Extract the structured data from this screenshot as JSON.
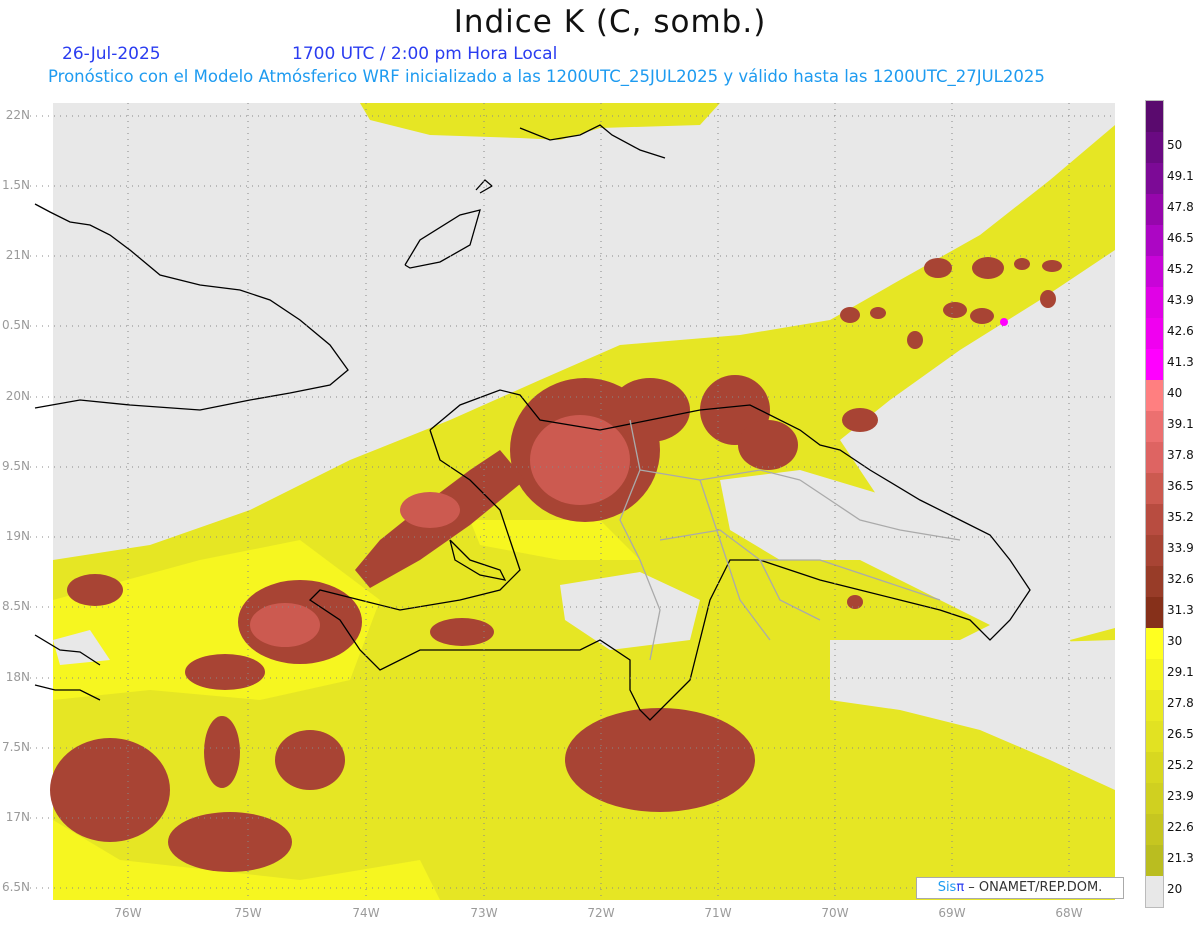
{
  "header": {
    "title": "Indice K (C, somb.)",
    "date": "26-Jul-2025",
    "time": "1700 UTC / 2:00 pm Hora Local",
    "subtitle": "Pronóstico con el Modelo Atmósferico WRF inicializado a las 1200UTC_25JUL2025 y válido hasta las  1200UTC_27JUL2025"
  },
  "axes": {
    "lat_labels": [
      "22N",
      "1.5N",
      "21N",
      "0.5N",
      "20N",
      "9.5N",
      "19N",
      "8.5N",
      "18N",
      "7.5N",
      "17N",
      "6.5N"
    ],
    "lon_labels": [
      "76W",
      "75W",
      "74W",
      "73W",
      "72W",
      "71W",
      "70W",
      "69W",
      "68W"
    ]
  },
  "colorbar": {
    "labels": [
      "50",
      "49.1",
      "47.8",
      "46.5",
      "45.2",
      "43.9",
      "42.6",
      "41.3",
      "40",
      "39.1",
      "37.8",
      "36.5",
      "35.2",
      "33.9",
      "32.6",
      "31.3",
      "30",
      "29.1",
      "27.8",
      "26.5",
      "25.2",
      "23.9",
      "22.6",
      "21.3",
      "20"
    ],
    "colors": [
      "#5a0a6e",
      "#6a0a82",
      "#7c0a96",
      "#9606ac",
      "#ac06c4",
      "#c804d8",
      "#e002e6",
      "#f000f0",
      "#ff00ff",
      "#ff7f80",
      "#ec7070",
      "#de6462",
      "#cc5a50",
      "#b84c40",
      "#a84434",
      "#983c28",
      "#86301a",
      "#ffff20",
      "#f4f420",
      "#eaea22",
      "#e2e222",
      "#d8d820",
      "#d0d020",
      "#c6c620",
      "#babd20",
      "#e8e8e8"
    ]
  },
  "credit": {
    "brand_a": "Sis",
    "brand_b": "π",
    "text": " –  ONAMET/REP.DOM."
  }
}
